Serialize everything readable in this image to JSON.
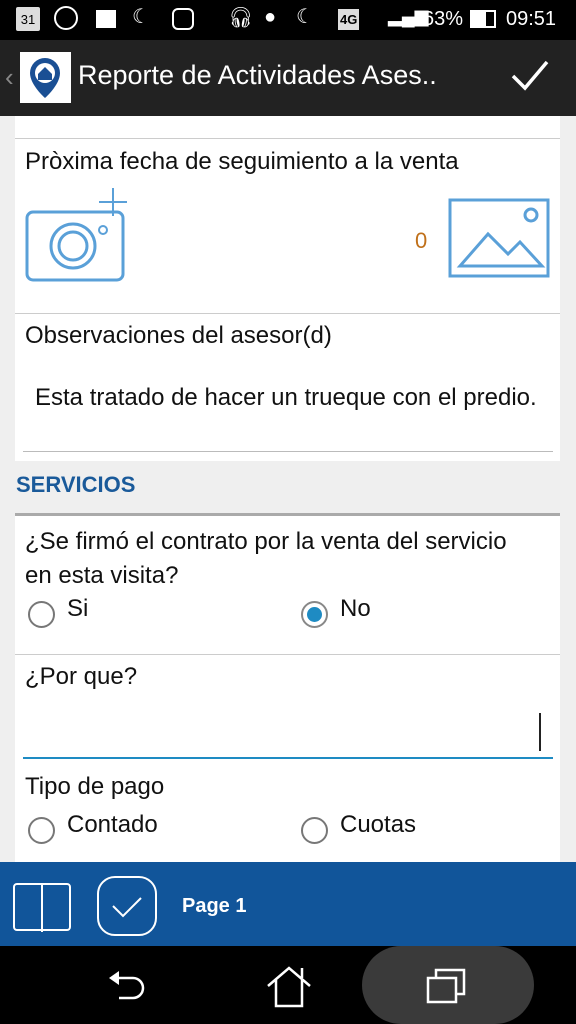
{
  "status_bar": {
    "calendar_day": "31",
    "network": "4G",
    "battery": "63%",
    "time": "09:51"
  },
  "toolbar": {
    "title": "Reporte de Actividades Ases.."
  },
  "form": {
    "next_followup_label": "Pròxima fecha de seguimiento a la venta",
    "photo_count": "0",
    "observations_label": "Observaciones del asesor(d)",
    "observations_value": "Esta tratado de hacer un trueque con el predio.",
    "section_title": "SERVICIOS",
    "contract_question": "¿Se firmó el contrato por la venta del servicio en esta visita?",
    "contract_options": [
      {
        "label": "Si",
        "selected": false
      },
      {
        "label": "No",
        "selected": true
      }
    ],
    "why_label": "¿Por que?",
    "why_value": "",
    "payment_label": "Tipo de pago",
    "payment_options": [
      {
        "label": "Contado",
        "selected": false
      },
      {
        "label": "Cuotas",
        "selected": false
      }
    ]
  },
  "bottom_bar": {
    "page_label": "Page 1"
  },
  "colors": {
    "accent": "#11559a",
    "radio": "#1e8bc3",
    "count": "#c0701a"
  }
}
